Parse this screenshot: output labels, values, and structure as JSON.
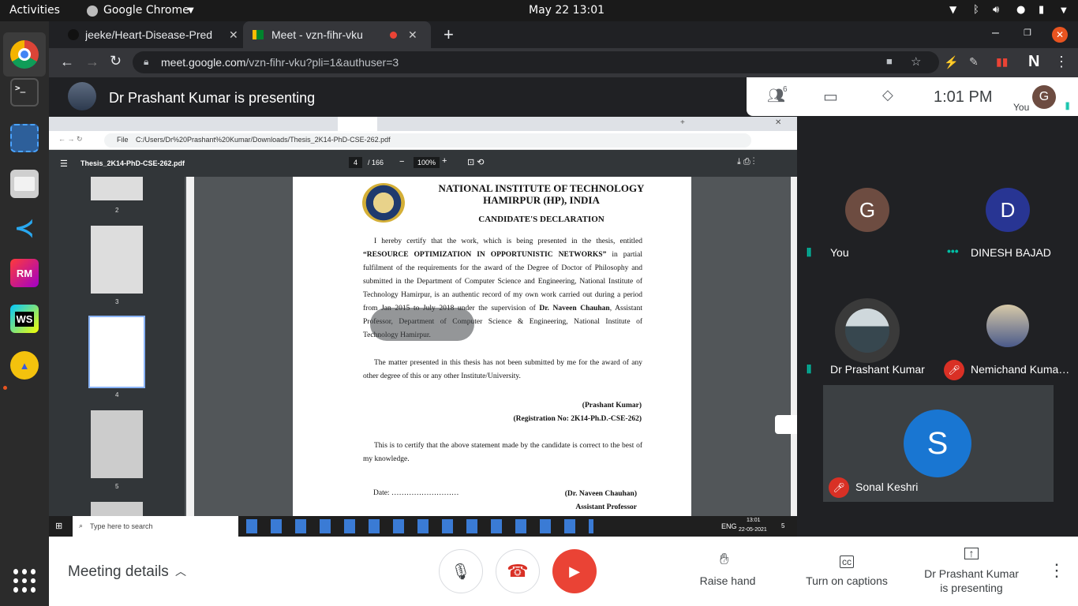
{
  "topbar": {
    "activities": "Activities",
    "app": "Google Chrome",
    "datetime": "May 22  13:01"
  },
  "tabs": [
    {
      "title": "jeeke/Heart-Disease-Pred"
    },
    {
      "title": "Meet - vzn-fihr-vku"
    }
  ],
  "omnibox": {
    "host": "meet.google.com",
    "path": "/vzn-fihr-vku?pli=1&authuser=3"
  },
  "presenter": {
    "banner": "Dr Prashant Kumar is presenting"
  },
  "callinfo": {
    "people_count": "6",
    "time": "1:01 PM",
    "you_label": "You",
    "avatar_letter": "G"
  },
  "shared": {
    "inner_url_prefix": "File",
    "inner_url": "C:/Users/Dr%20Prashant%20Kumar/Downloads/Thesis_2K14-PhD-CSE-262.pdf",
    "pdf_title": "Thesis_2K14-PhD-CSE-262.pdf",
    "page_current": "4",
    "page_total": "/ 166",
    "zoom": "100%",
    "thumb_labels": [
      "2",
      "3",
      "4",
      "5"
    ],
    "doc": {
      "inst_line1": "NATIONAL INSTITUTE OF TECHNOLOGY",
      "inst_line2": "HAMIRPUR (HP), INDIA",
      "heading": "CANDIDATE'S DECLARATION",
      "para1_a": "I hereby certify that the work, which is being presented in the thesis, entitled",
      "para1_title": "“RESOURCE OPTIMIZATION IN OPPORTUNISTIC NETWORKS”",
      "para1_b": " in partial fulfilment of the requirements for the award of the Degree of Doctor of Philosophy and submitted in the Department of Computer Science and Engineering, National Institute of Technology Hamirpur, is an authentic record of my own work carried out during a period from Jan 2015 to July 2018 under the supervision of ",
      "para1_sup": "Dr. Naveen Chauhan",
      "para1_c": ", Assistant Professor, Department of Computer Science & Engineering, National Institute of Technology Hamirpur.",
      "para2": "The matter presented in this thesis has not been submitted by me for the award of any other degree of this or any other Institute/University.",
      "sign_name": "(Prashant Kumar)",
      "sign_reg": "(Registration No: 2K14-Ph.D.-CSE-262)",
      "para3": "This is to certify that the above statement made by the candidate is correct to the best of my knowledge.",
      "date": "Date: ………………………",
      "sup_name": "(Dr. Naveen Chauhan)",
      "sup_title": "Assistant Professor"
    },
    "taskbar": {
      "search": "Type here to search",
      "lang": "ENG",
      "time": "13:01",
      "date": "22-05-2021",
      "notif": "5"
    }
  },
  "participants": [
    {
      "name": "You",
      "letter": "G",
      "color": "#6d4c41"
    },
    {
      "name": "DINESH BAJAD",
      "letter": "D",
      "color": "#283593"
    },
    {
      "name": "Dr Prashant Kumar"
    },
    {
      "name": "Nemichand Kuma…"
    },
    {
      "name": "Sonal Keshri",
      "letter": "S",
      "color": "#1976d2"
    }
  ],
  "bottom": {
    "meeting_details": "Meeting details",
    "raise_hand": "Raise hand",
    "captions": "Turn on captions",
    "presenting_line1": "Dr Prashant Kumar",
    "presenting_line2": "is presenting"
  },
  "colors": {
    "accent_red": "#ea4335",
    "meet_bg": "#202124",
    "speaking": "#00bfa5"
  }
}
